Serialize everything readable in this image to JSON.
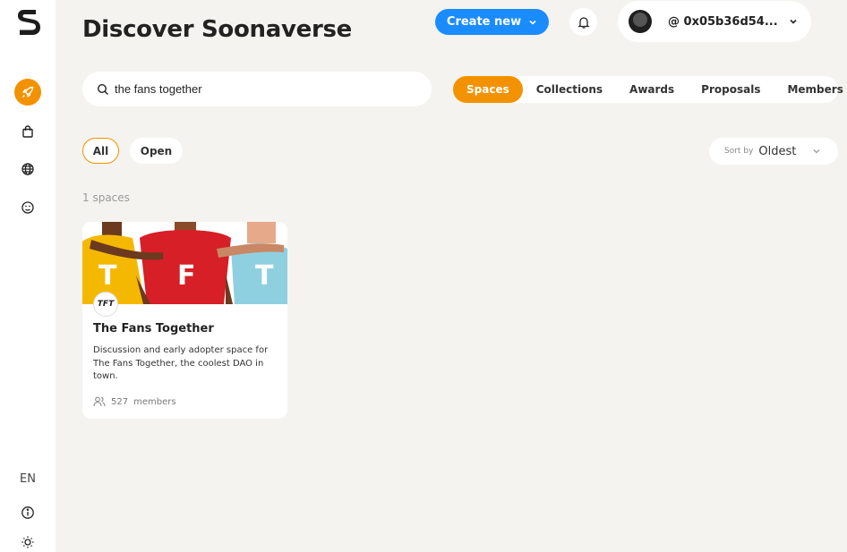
{
  "sidebar": {
    "logo_icon": "soonaverse-logo",
    "items": [
      {
        "icon": "rocket-icon",
        "active": true
      },
      {
        "icon": "shopping-bag-icon",
        "active": false
      },
      {
        "icon": "globe-icon",
        "active": false
      },
      {
        "icon": "smiley-icon",
        "active": false
      }
    ],
    "language": "EN",
    "bottom_icons": [
      "info-icon",
      "sun-icon"
    ]
  },
  "header": {
    "title": "Discover Soonaverse",
    "create_label": "Create new",
    "profile_name": "@ 0x05b36d54..."
  },
  "search": {
    "value": "the fans together"
  },
  "tabs": [
    {
      "label": "Spaces",
      "active": true
    },
    {
      "label": "Collections",
      "active": false
    },
    {
      "label": "Awards",
      "active": false
    },
    {
      "label": "Proposals",
      "active": false
    },
    {
      "label": "Members",
      "active": false
    }
  ],
  "filters": [
    {
      "label": "All",
      "active": true
    },
    {
      "label": "Open",
      "active": false
    }
  ],
  "sort": {
    "label": "Sort by",
    "value": "Oldest"
  },
  "result_count": "1 spaces",
  "cards": [
    {
      "banner_letters": [
        "T",
        "F",
        "T"
      ],
      "logo_text": "TFT",
      "title": "The Fans Together",
      "description": "Discussion and early adopter space for The Fans Together, the coolest DAO in town.",
      "member_count": "527",
      "member_label": "members"
    }
  ],
  "colors": {
    "accent": "#f39200",
    "primary": "#1a8cff",
    "background": "#f5f3ef"
  }
}
